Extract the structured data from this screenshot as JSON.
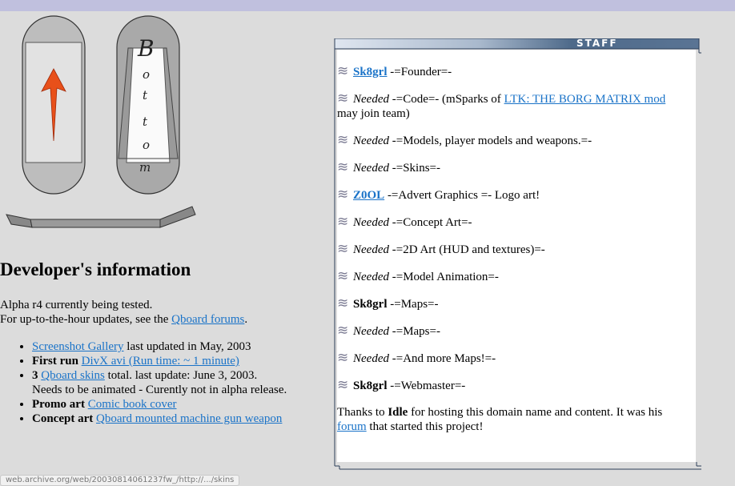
{
  "logo": {
    "letters": [
      "B",
      "o",
      "t",
      "t",
      "o",
      "m"
    ]
  },
  "developer": {
    "title": "Developer's information",
    "status_line": "Alpha r4 currently being tested.",
    "updates_prefix": "For up-to-the-hour updates, see the",
    "forums_link": "Qboard forums",
    "updates_suffix": ".",
    "items": [
      {
        "link": "Screenshot Gallery",
        "text": " last updated in May, 2003"
      },
      {
        "bold": "First run",
        "link": "DivX avi (Run time: ~ 1 minute)"
      },
      {
        "bold": "3",
        "link": "Qboard skins",
        "text": " total. last update: June 3, 2003.",
        "text2": "Needs to be animated - Curently not in alpha release."
      },
      {
        "bold": "Promo art",
        "link": "Comic book cover"
      },
      {
        "bold": "Concept art",
        "link": "Qboard mounted machine gun weapon"
      }
    ]
  },
  "staff": {
    "header": "STAFF",
    "wave_glyph": "≋",
    "entries": [
      {
        "name": "Sk8grl",
        "linked": true,
        "role": " -=Founder=-"
      },
      {
        "needed": "Needed",
        "role": " -=Code=- (mSparks of ",
        "link": "LTK: THE BORG MATRIX mod",
        "role2": "may join team)"
      },
      {
        "needed": "Needed",
        "role": " -=Models, player models and weapons.=-"
      },
      {
        "needed": "Needed",
        "role": " -=Skins=-"
      },
      {
        "name": "Z0OL",
        "linked": true,
        "role": " -=Advert Graphics =- Logo art!"
      },
      {
        "needed": "Needed",
        "role": " -=Concept Art=-"
      },
      {
        "needed": "Needed",
        "role": " -=2D Art (HUD and textures)=-"
      },
      {
        "needed": "Needed",
        "role": " -=Model Animation=-"
      },
      {
        "name": "Sk8grl",
        "linked": false,
        "role": " -=Maps=-"
      },
      {
        "needed": "Needed",
        "role": " -=Maps=-"
      },
      {
        "needed": "Needed",
        "role": " -=And more Maps!=-"
      },
      {
        "name": "Sk8grl",
        "linked": false,
        "role": " -=Webmaster=-"
      }
    ],
    "thanks_prefix": "Thanks to ",
    "thanks_name": "Idle",
    "thanks_mid": " for hosting this domain name and content. It was his",
    "thanks_link": "forum",
    "thanks_suffix": " that started this project!"
  },
  "status_bar": {
    "url": "web.archive.org/web/20030814061237fw_/http://.../skins"
  }
}
